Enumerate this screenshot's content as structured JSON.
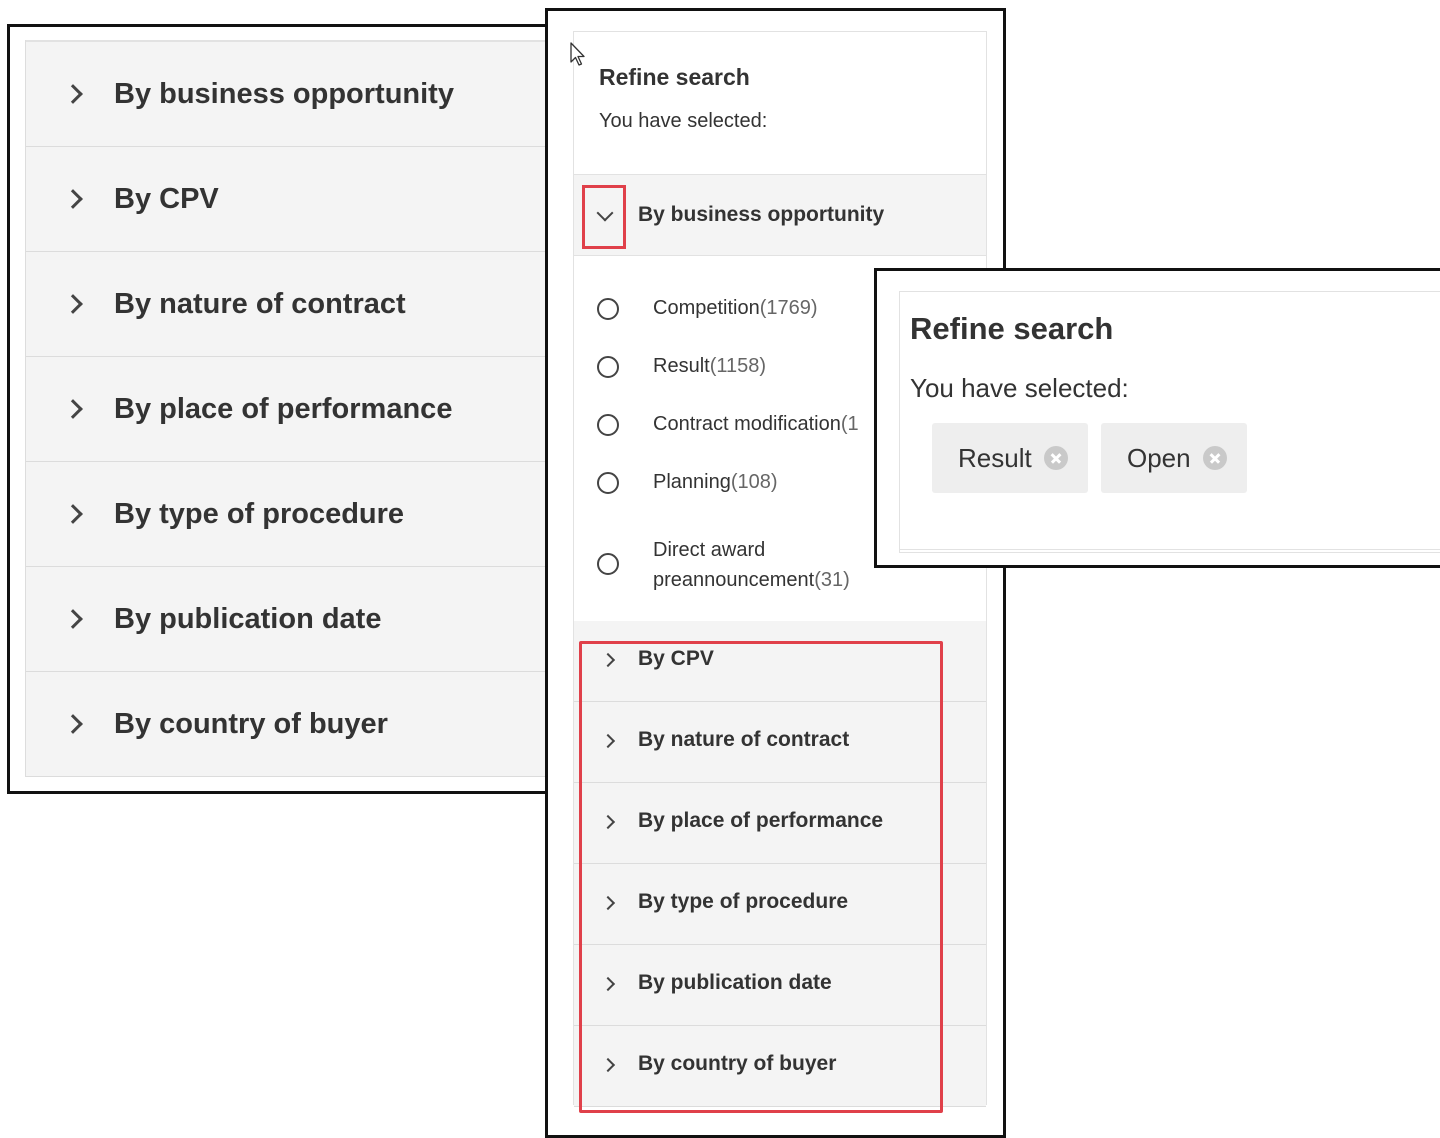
{
  "panel1": {
    "rows": [
      {
        "label": "By business opportunity"
      },
      {
        "label": "By CPV"
      },
      {
        "label": "By nature of contract"
      },
      {
        "label": "By place of performance"
      },
      {
        "label": "By type of procedure"
      },
      {
        "label": "By publication date"
      },
      {
        "label": "By country of buyer"
      }
    ]
  },
  "panel2": {
    "title": "Refine search",
    "selected_label": "You have selected:",
    "expanded_section": {
      "label": "By business opportunity"
    },
    "options": [
      {
        "label": "Competition",
        "count": "(1769)"
      },
      {
        "label": "Result",
        "count": "(1158)"
      },
      {
        "label": "Contract modification",
        "count": "(1"
      },
      {
        "label": "Planning",
        "count": "(108)"
      },
      {
        "label_line1": "Direct award",
        "label_line2": "preannouncement",
        "count": "(31)"
      }
    ],
    "collapsed_sections": [
      {
        "label": "By CPV"
      },
      {
        "label": "By nature of contract"
      },
      {
        "label": "By place of performance"
      },
      {
        "label": "By type of procedure"
      },
      {
        "label": "By publication date"
      },
      {
        "label": "By country of buyer"
      }
    ]
  },
  "panel3": {
    "title": "Refine search",
    "selected_label": "You have selected:",
    "chips": [
      {
        "label": "Result"
      },
      {
        "label": "Open"
      }
    ]
  },
  "colors": {
    "highlight": "#e0404a",
    "row_bg": "#f4f4f4",
    "chip_bg": "#eeeeee"
  }
}
